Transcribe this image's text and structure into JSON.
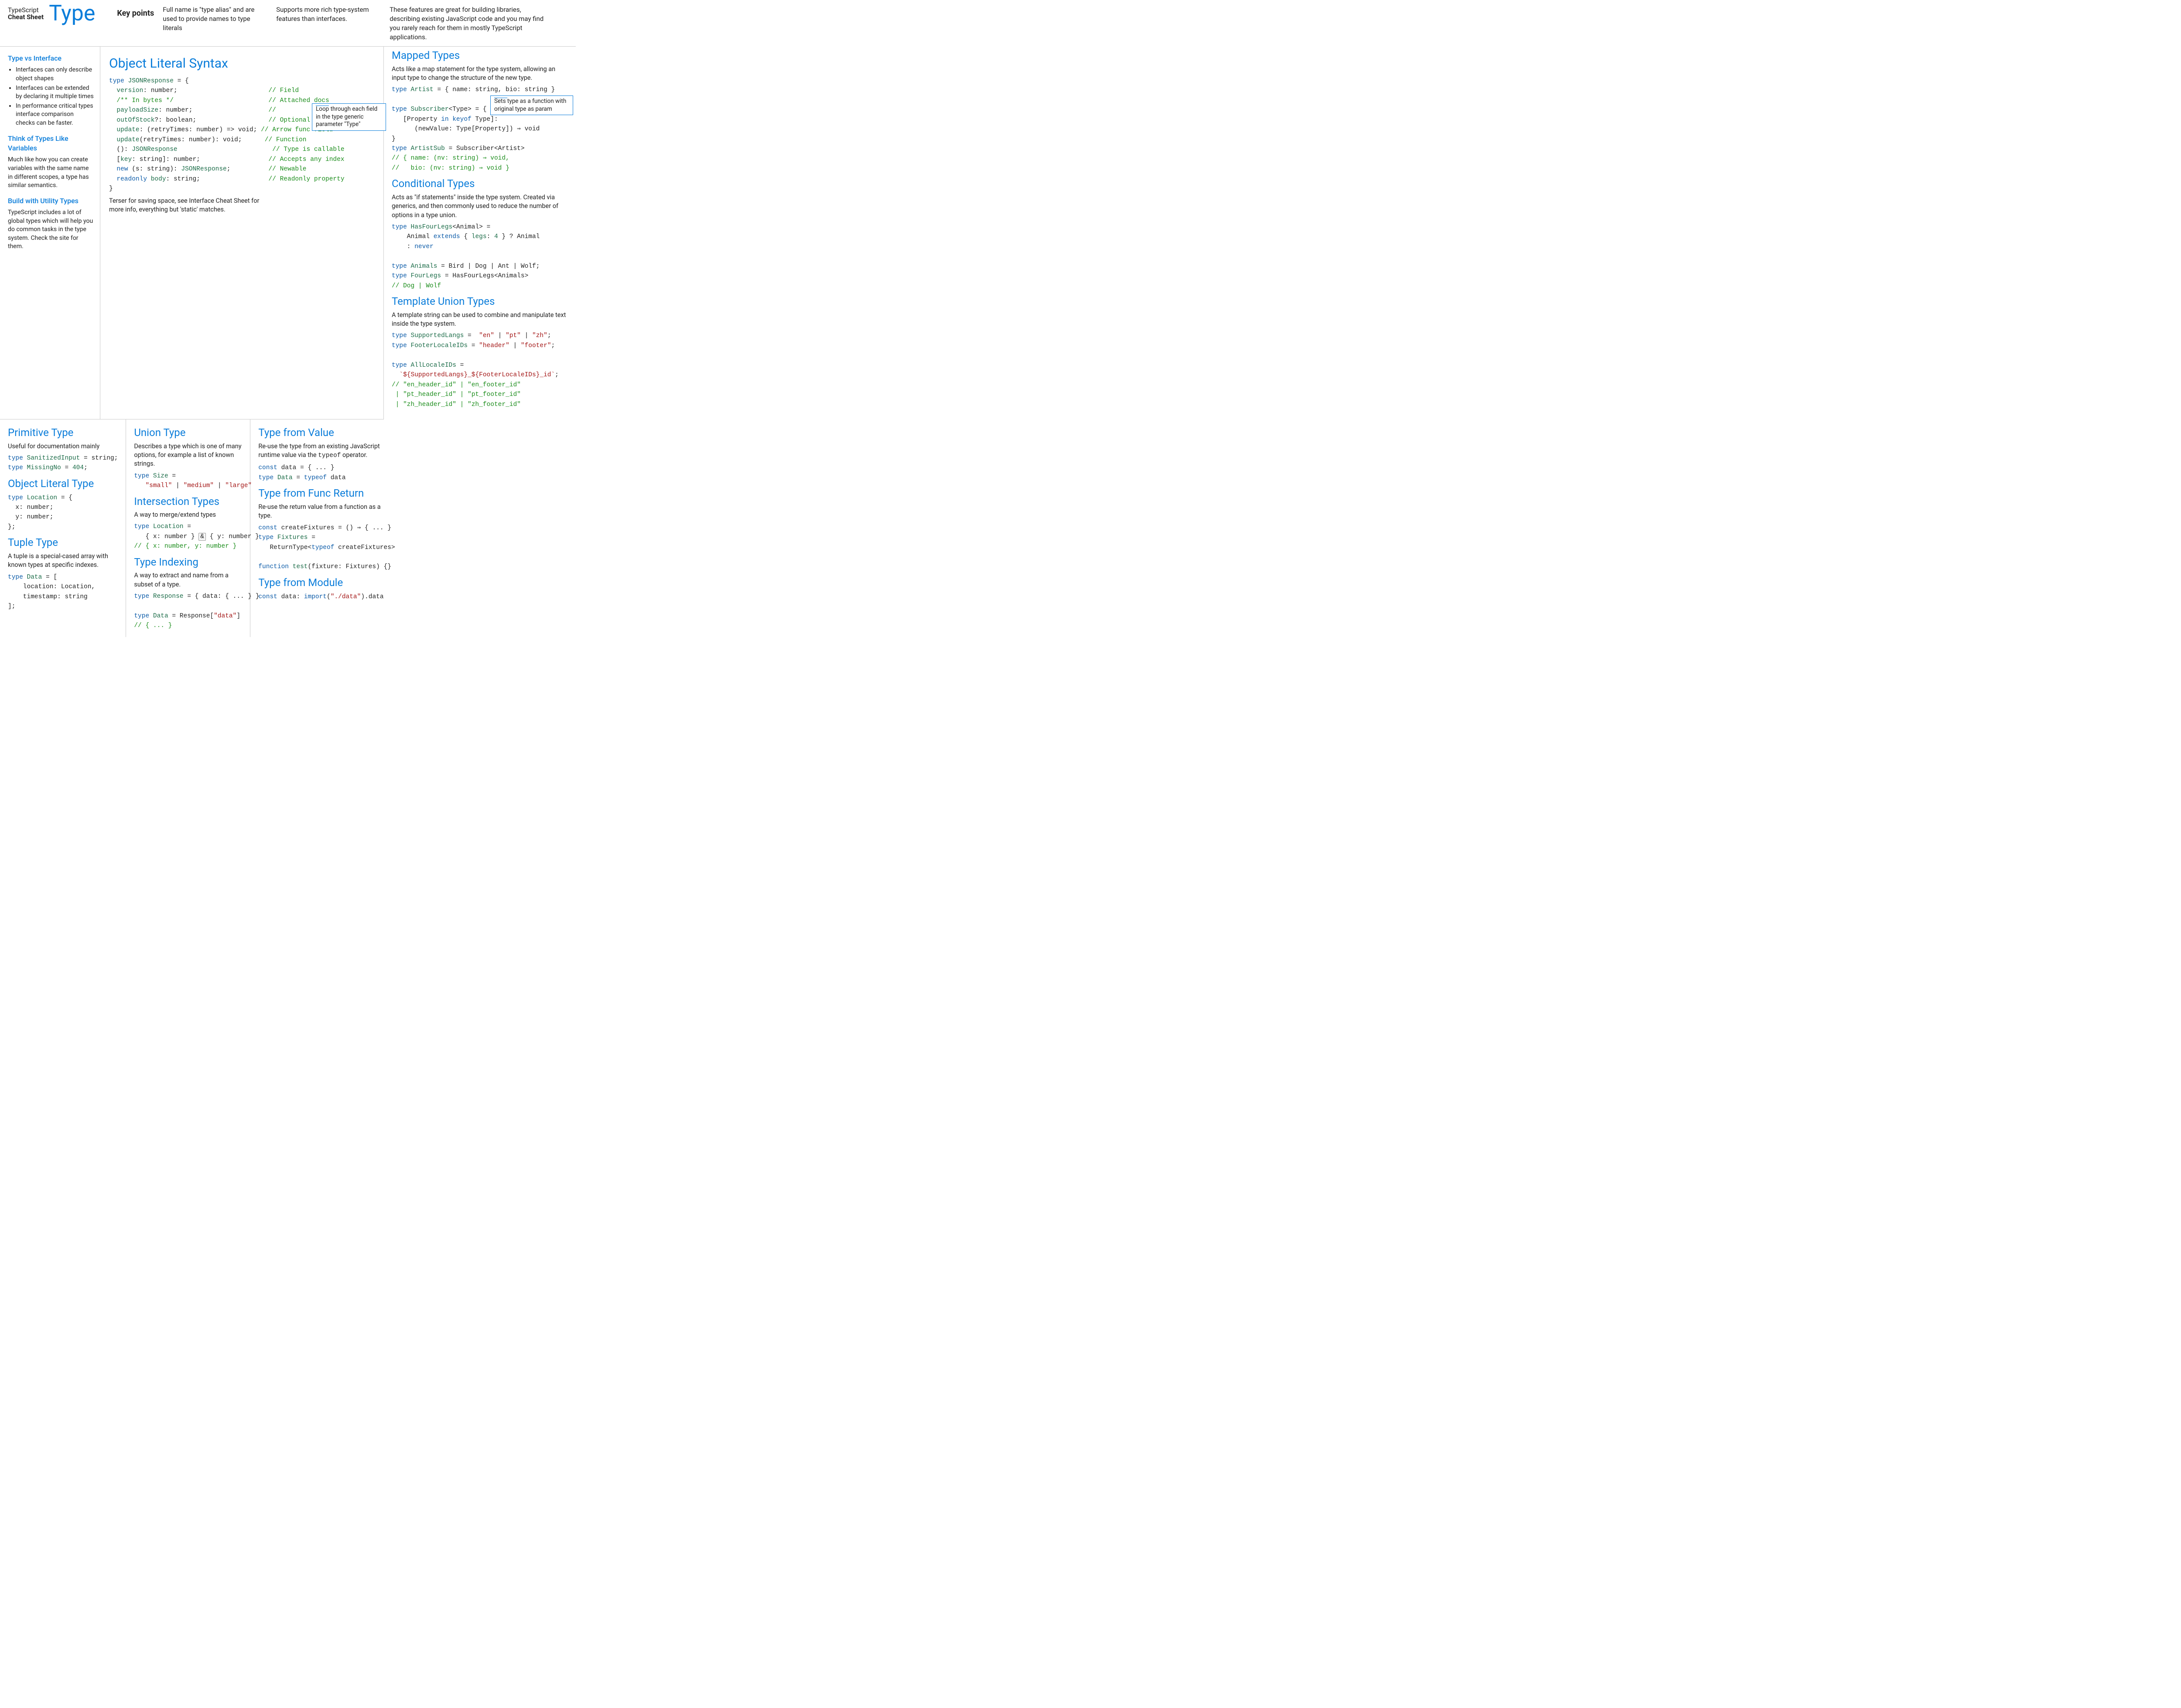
{
  "header": {
    "brand_line1": "TypeScript",
    "brand_line2": "Cheat Sheet",
    "brand_big": "Type",
    "key_points_label": "Key points",
    "kp1": "Full name is \"type alias\" and are used to provide names to type literals",
    "kp2": "Supports more rich type-system features than interfaces.",
    "kp3": "These features are great for building libraries, describing existing JavaScript code and you may find you rarely reach for them in mostly TypeScript applications."
  },
  "sidebar": {
    "h1": "Type vs Interface",
    "bullets": [
      "Interfaces can only describe object shapes",
      "Interfaces can be extended by declaring it multiple times",
      "In performance critical types interface comparison checks can be faster."
    ],
    "h2": "Think of Types Like Variables",
    "p2": "Much like how you can create variables with the same name in different scopes, a type has similar semantics.",
    "h3": "Build with Utility Types",
    "p3": "TypeScript includes a lot of global types which will help you do common tasks in the type system. Check the site for them."
  },
  "obj_literal": {
    "title": "Object Literal Syntax",
    "code_html": "<span class='kw'>type</span> <span class='ty'>JSONResponse</span> = {\n  <span class='id'>version</span>: number;                        <span class='cmt'>// Field</span>\n  <span class='cmt'>/** In bytes */</span>                         <span class='cmt'>// Attached docs</span>\n  <span class='id'>payloadSize</span>: number;                    <span class='cmt'>//</span>\n  <span class='id'>outOfStock</span>?: boolean;                   <span class='cmt'>// Optional</span>\n  <span class='id'>update</span>: (retryTimes: number) =&gt; void; <span class='cmt'>// Arrow func field</span>\n  <span class='id'>update</span>(retryTimes: number): void;      <span class='cmt'>// Function</span>\n  (): <span class='ty'>JSONResponse</span>                         <span class='cmt'>// Type is callable</span>\n  [<span class='id'>key</span>: string]: number;                  <span class='cmt'>// Accepts any index</span>\n  <span class='kw'>new</span> (s: string): <span class='ty'>JSONResponse</span>;          <span class='cmt'>// Newable</span>\n  <span class='kw'>readonly</span> <span class='id'>body</span>: string;                  <span class='cmt'>// Readonly property</span>\n}",
    "note": "Terser for saving space, see Interface Cheat Sheet for more info, everything but 'static' matches."
  },
  "right_top": {
    "mapped_title": "Mapped Types",
    "mapped_desc": "Acts like a map statement for the type system, allowing an input type to change the structure of the new type.",
    "mapped_code_html": "<span class='kw'>type</span> <span class='ty'>Artist</span> = { name: string, bio: string }\n\n<span class='kw'>type</span> <span class='ty'>Subscriber</span>&lt;Type&gt; = {\n   [Property <span class='kw'>in keyof</span> Type]:\n      (newValue: Type[Property]) ⇒ void\n}\n<span class='kw'>type</span> <span class='ty'>ArtistSub</span> = Subscriber&lt;Artist&gt;\n<span class='cmt'>// { name: (nv: string) ⇒ void,</span>\n<span class='cmt'>//   bio: (nv: string) ⇒ void }</span>",
    "callout_left": "Loop through each field in the type generic parameter \"Type\"",
    "callout_right": "Sets type as a function with original type as param",
    "cond_title": "Conditional Types",
    "cond_desc": "Acts as \"if statements\"  inside the type system. Created via generics, and then commonly used to reduce the number of options in a type union.",
    "cond_code_html": "<span class='kw'>type</span> <span class='ty'>HasFourLegs</span>&lt;Animal&gt; =\n    Animal <span class='kw'>extends</span> { <span class='id'>legs</span>: <span class='num'>4</span> } ? Animal\n    : <span class='kw'>never</span>\n\n<span class='kw'>type</span> <span class='ty'>Animals</span> = Bird | Dog | Ant | Wolf;\n<span class='kw'>type</span> <span class='ty'>FourLegs</span> = HasFourLegs&lt;Animals&gt;\n<span class='cmt'>// Dog | Wolf</span>",
    "tmpl_title": "Template Union Types",
    "tmpl_desc": "A template string can be used to combine and manipulate text inside the type system.",
    "tmpl_code_html": "<span class='kw'>type</span> <span class='ty'>SupportedLangs</span> =  <span class='str'>\"en\"</span> | <span class='str'>\"pt\"</span> | <span class='str'>\"zh\"</span>;\n<span class='kw'>type</span> <span class='ty'>FooterLocaleIDs</span> = <span class='str'>\"header\"</span> | <span class='str'>\"footer\"</span>;\n\n<span class='kw'>type</span> <span class='ty'>AllLocaleIDs</span> =\n  <span class='str'>`${SupportedLangs}_${FooterLocaleIDs}_id`</span>;\n<span class='cmt'>// \"en_header_id\" | \"en_footer_id\"</span>\n<span class='cmt'> | \"pt_header_id\" | \"pt_footer_id\"</span>\n<span class='cmt'> | \"zh_header_id\" | \"zh_footer_id\"</span>"
  },
  "bottom": {
    "c1": {
      "prim_title": "Primitive Type",
      "prim_desc": "Useful for documentation mainly",
      "prim_code_html": "<span class='kw'>type</span> <span class='ty'>SanitizedInput</span> = string;\n<span class='kw'>type</span> <span class='ty'>MissingNo</span> = <span class='num'>404</span>;",
      "obj_title": "Object Literal Type",
      "obj_code_html": "<span class='kw'>type</span> <span class='ty'>Location</span> = {\n  x: number;\n  y: number;\n};",
      "tup_title": "Tuple Type",
      "tup_desc": "A tuple is a special-cased array with known types at specific indexes.",
      "tup_code_html": "<span class='kw'>type</span> <span class='ty'>Data</span> = [\n    location: Location,\n    timestamp: string\n];"
    },
    "c2": {
      "union_title": "Union Type",
      "union_desc": "Describes a type which is one of many options, for example a list of known strings.",
      "union_code_html": "<span class='kw'>type</span> <span class='ty'>Size</span> =\n   <span class='str'>\"small\"</span> | <span class='str'>\"medium\"</span> | <span class='str'>\"large\"</span>",
      "inter_title": "Intersection Types",
      "inter_desc": "A way to merge/extend types",
      "inter_code_html": "<span class='kw'>type</span> <span class='ty'>Location</span> =\n   { x: number } <span class='boxed'>&amp;</span> { y: number }\n<span class='cmt'>// { x: number, y: number }</span>",
      "idx_title": "Type Indexing",
      "idx_desc": "A way to extract and name from a subset of a type.",
      "idx_code_html": "<span class='kw'>type</span> <span class='ty'>Response</span> = { data: { ... } }\n\n<span class='kw'>type</span> <span class='ty'>Data</span> = Response[<span class='str'>\"data\"</span>]\n<span class='cmt'>// { ... }</span>"
    },
    "c3": {
      "val_title": "Type from Value",
      "val_desc_html": "Re-use the type from an existing JavaScript runtime value via the <code>typeof</code> operator.",
      "val_code_html": "<span class='kw'>const</span> data = { ... }\n<span class='kw'>type</span> <span class='ty'>Data</span> = <span class='kw'>typeof</span> data",
      "ret_title": "Type from Func Return",
      "ret_desc": "Re-use the return value from a function as a type.",
      "ret_code_html": "<span class='kw'>const</span> createFixtures = () ⇒ { ... }\n<span class='kw'>type</span> <span class='ty'>Fixtures</span> =\n   ReturnType&lt;<span class='kw'>typeof</span> createFixtures&gt;\n\n<span class='kw'>function</span> <span class='id'>test</span>(fixture: Fixtures) {}",
      "mod_title": "Type from Module",
      "mod_code_html": "<span class='kw'>const</span> data: <span class='kw'>import</span>(<span class='str'>\"./data\"</span>).data"
    }
  }
}
